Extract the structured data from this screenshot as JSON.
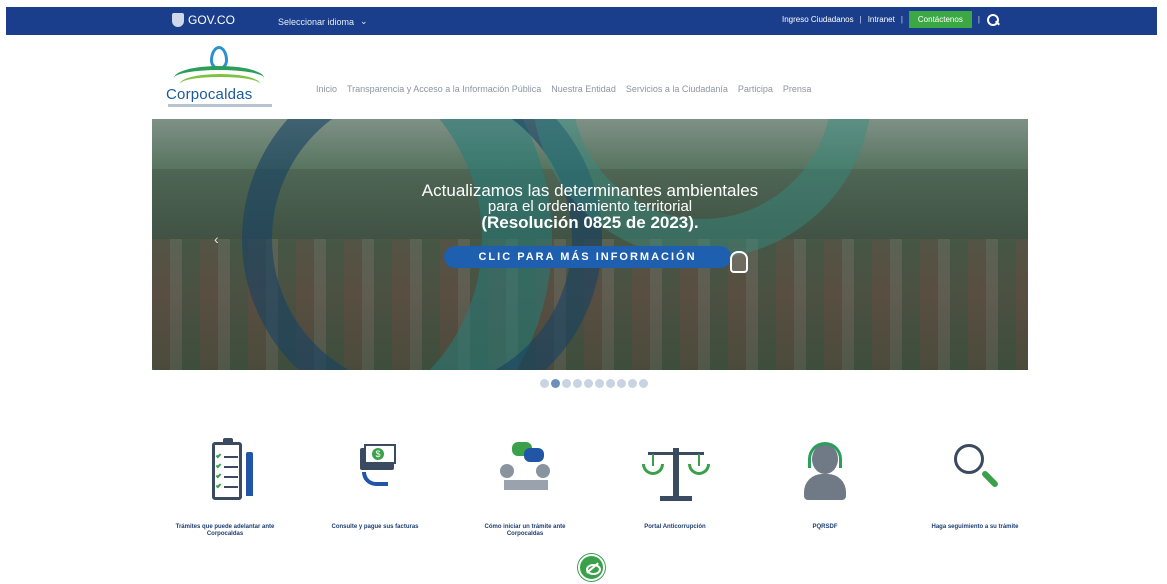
{
  "gov_bar": {
    "gov_label": "GOV.CO",
    "language_label": "Seleccionar idioma",
    "links": [
      "Ingreso Ciudadanos",
      "Intranet"
    ],
    "contact_label": "Contáctenos",
    "colors": {
      "bar": "#1a3e8c",
      "contact": "#3ca844"
    }
  },
  "header": {
    "brand_name": "Corpocaldas",
    "nav": [
      "Inicio",
      "Transparencia y Acceso a la Información Pública",
      "Nuestra Entidad",
      "Servicios a la Ciudadanía",
      "Participa",
      "Prensa"
    ]
  },
  "hero": {
    "line1": "Actualizamos las determinantes ambientales",
    "line2": "para el ordenamiento territorial",
    "line3": "(Resolución 0825 de 2023).",
    "cta_label": "CLIC PARA MÁS INFORMACIÓN",
    "prev_arrow": "‹",
    "slide_count": 10,
    "active_slide": 2
  },
  "services": [
    {
      "label": "Trámites que puede adelantar ante Corpocaldas",
      "icon": "clipboard-checklist-icon"
    },
    {
      "label": "Consulte y pague sus facturas",
      "icon": "pay-bill-icon"
    },
    {
      "label": "Cómo iniciar un trámite ante Corpocaldas",
      "icon": "meeting-icon"
    },
    {
      "label": "Portal Anticorrupción",
      "icon": "scale-icon"
    },
    {
      "label": "PQRSDF",
      "icon": "headset-agent-icon"
    },
    {
      "label": "Haga seguimiento a su trámite",
      "icon": "magnifier-icon"
    }
  ],
  "accessibility": {
    "icon": "accessibility-eye-icon",
    "color": "#3aa14a"
  }
}
